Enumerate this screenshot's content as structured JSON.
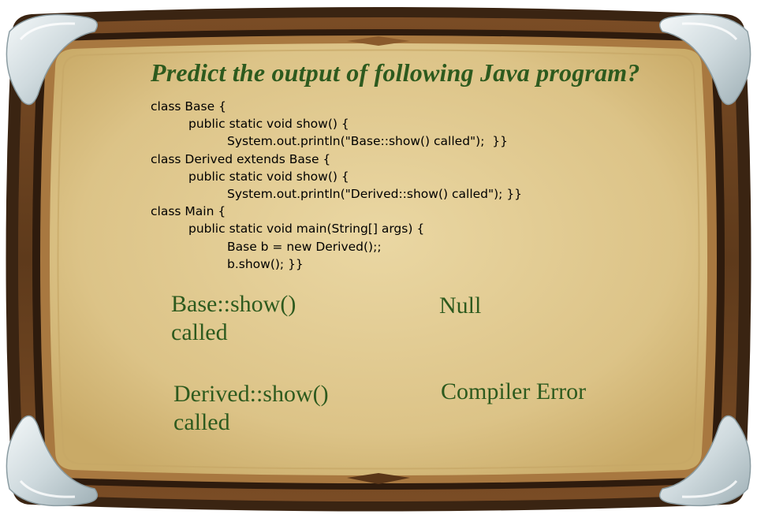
{
  "slide": {
    "title": "Predict the output of following Java program?",
    "code_lines": [
      "class Base {",
      "public static void show() {",
      "System.out.println(\"Base::show() called\");  }}",
      "class Derived extends Base {",
      "public static void show() {",
      "System.out.println(\"Derived::show() called\"); }}",
      "class Main {",
      "public static void main(String[] args) {",
      "Base b = new Derived();;",
      "b.show(); }}"
    ],
    "options": [
      {
        "line1": "Base::show()",
        "line2": "called"
      },
      {
        "line1": "Null",
        "line2": ""
      },
      {
        "line1": "Derived::show()",
        "line2": "called"
      },
      {
        "line1": "Compiler Error",
        "line2": ""
      }
    ]
  },
  "colors": {
    "frame_dark": "#3a2412",
    "frame_mid": "#6b4423",
    "frame_light": "#a06a38",
    "parchment": "#e0c98d",
    "text_green": "#2d5a1e"
  }
}
